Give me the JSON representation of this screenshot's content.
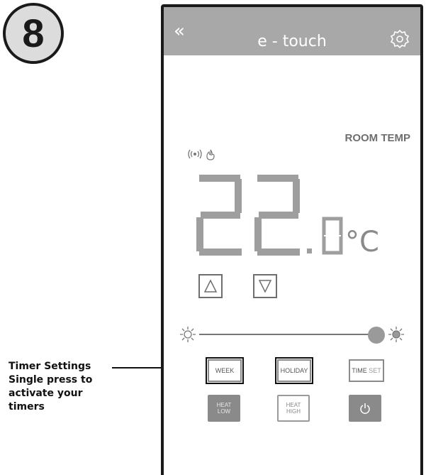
{
  "step_badge": {
    "number": "8"
  },
  "callout": {
    "text": "Timer Settings Single press to activate your timers"
  },
  "app": {
    "header": {
      "back_icon": "double-chevron-left-icon",
      "title": "e - touch",
      "settings_icon": "gear-icon"
    },
    "room_temp_label": "ROOM TEMP",
    "status_icons": [
      "wireless-signal-icon",
      "flame-icon"
    ],
    "temperature": {
      "integer": "22",
      "decimal": "0",
      "unit": "°C"
    },
    "controls": {
      "increase_icon": "triangle-up-icon",
      "decrease_icon": "triangle-down-icon"
    },
    "brightness": {
      "low_icon": "sun-outline-icon",
      "high_icon": "sun-filled-icon",
      "value_fraction": 0.95
    },
    "timer_buttons": {
      "week": "WEEK",
      "holiday": "HOLIDAY",
      "time": "TIME",
      "set": "SET"
    },
    "mode_buttons": {
      "heat_low_line1": "HEAT",
      "heat_low_line2": "LOW",
      "heat_high_line1": "HEAT",
      "heat_high_line2": "HIGH",
      "power_icon": "power-icon"
    },
    "colors": {
      "header_bg": "#a8a8a8",
      "active_button": "#8a8a8a",
      "digits": "#9e9e9e"
    }
  }
}
